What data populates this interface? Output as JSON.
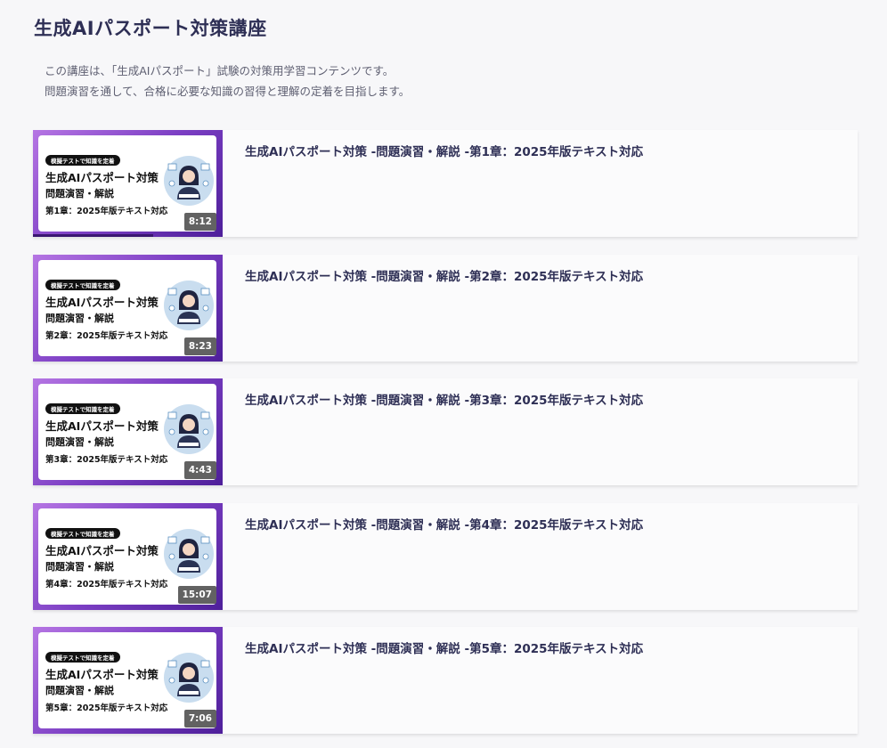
{
  "page": {
    "title": "生成AIパスポート対策講座",
    "description": [
      "この講座は、「生成AIパスポート」試験の対策用学習コンテンツです。",
      "問題演習を通して、合格に必要な知識の習得と理解の定着を目指します。"
    ]
  },
  "videos": [
    {
      "title": "生成AIパスポート対策 -問題演習・解説 -第1章：2025年版テキスト対応",
      "thumb_tag": "模擬テストで知識を定着",
      "thumb_title": "生成AIパスポート対策",
      "thumb_subtitle": "問題演習・解説",
      "thumb_chapter": "第1章：2025年版テキスト対応",
      "duration": "8:12"
    },
    {
      "title": "生成AIパスポート対策 -問題演習・解説 -第2章：2025年版テキスト対応",
      "thumb_tag": "模擬テストで知識を定着",
      "thumb_title": "生成AIパスポート対策",
      "thumb_subtitle": "問題演習・解説",
      "thumb_chapter": "第2章：2025年版テキスト対応",
      "duration": "8:23"
    },
    {
      "title": "生成AIパスポート対策 -問題演習・解説 -第3章：2025年版テキスト対応",
      "thumb_tag": "模擬テストで知識を定着",
      "thumb_title": "生成AIパスポート対策",
      "thumb_subtitle": "問題演習・解説",
      "thumb_chapter": "第3章：2025年版テキスト対応",
      "duration": "4:43"
    },
    {
      "title": "生成AIパスポート対策 -問題演習・解説 -第4章：2025年版テキスト対応",
      "thumb_tag": "模擬テストで知識を定着",
      "thumb_title": "生成AIパスポート対策",
      "thumb_subtitle": "問題演習・解説",
      "thumb_chapter": "第4章：2025年版テキスト対応",
      "duration": "15:07"
    },
    {
      "title": "生成AIパスポート対策 -問題演習・解説 -第5章：2025年版テキスト対応",
      "thumb_tag": "模擬テストで知識を定着",
      "thumb_title": "生成AIパスポート対策",
      "thumb_subtitle": "問題演習・解説",
      "thumb_chapter": "第5章：2025年版テキスト対応",
      "duration": "7:06"
    }
  ]
}
